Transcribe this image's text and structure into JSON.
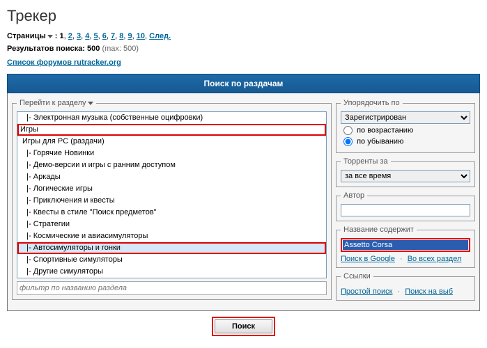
{
  "header": {
    "title": "Трекер",
    "pages_label": "Страницы",
    "current_page": "1",
    "page_links": [
      "2",
      "3",
      "4",
      "5",
      "6",
      "7",
      "8",
      "9",
      "10"
    ],
    "next_label": "След.",
    "results_label": "Результатов поиска:",
    "results_count": "500",
    "results_max": "(max: 500)",
    "forum_list_link": "Список форумов rutracker.org"
  },
  "search_header": "Поиск по раздачам",
  "goto_section": {
    "legend": "Перейти к разделу",
    "filter_placeholder": "фильтр по названию раздела",
    "options": [
      {
        "text": "   |- Электронная музыка (собственные оцифровки)",
        "hl": false,
        "sel": false
      },
      {
        "text": "Игры",
        "hl": true,
        "sel": false
      },
      {
        "text": " Игры для PC (раздачи)",
        "hl": false,
        "sel": false
      },
      {
        "text": "   |- Горячие Новинки",
        "hl": false,
        "sel": false
      },
      {
        "text": "   |- Демо-версии и игры с ранним доступом",
        "hl": false,
        "sel": false
      },
      {
        "text": "   |- Аркады",
        "hl": false,
        "sel": false
      },
      {
        "text": "   |- Логические игры",
        "hl": false,
        "sel": false
      },
      {
        "text": "   |- Приключения и квесты",
        "hl": false,
        "sel": false
      },
      {
        "text": "   |- Квесты в стиле \"Поиск предметов\"",
        "hl": false,
        "sel": false
      },
      {
        "text": "   |- Стратегии",
        "hl": false,
        "sel": false
      },
      {
        "text": "   |- Космические и авиасимуляторы",
        "hl": false,
        "sel": false
      },
      {
        "text": "   |- Автосимуляторы и гонки",
        "hl": true,
        "sel": true
      },
      {
        "text": "   |- Спортивные симуляторы",
        "hl": false,
        "sel": false
      },
      {
        "text": "   |- Другие симуляторы",
        "hl": false,
        "sel": false
      }
    ]
  },
  "sort": {
    "legend": "Упорядочить по",
    "selected": "Зарегистрирован",
    "asc_label": "по возрастанию",
    "desc_label": "по убыванию"
  },
  "torrents_for": {
    "legend": "Торренты за",
    "selected": "за все время"
  },
  "author": {
    "legend": "Автор",
    "value": ""
  },
  "title_contains": {
    "legend": "Название содержит",
    "value": "Assetto Corsa",
    "google_link": "Поиск в Google",
    "all_link": "Во всех раздел"
  },
  "links": {
    "legend": "Ссылки",
    "simple_search": "Простой поиск",
    "new_tab": "Поиск на выб"
  },
  "submit_label": "Поиск"
}
